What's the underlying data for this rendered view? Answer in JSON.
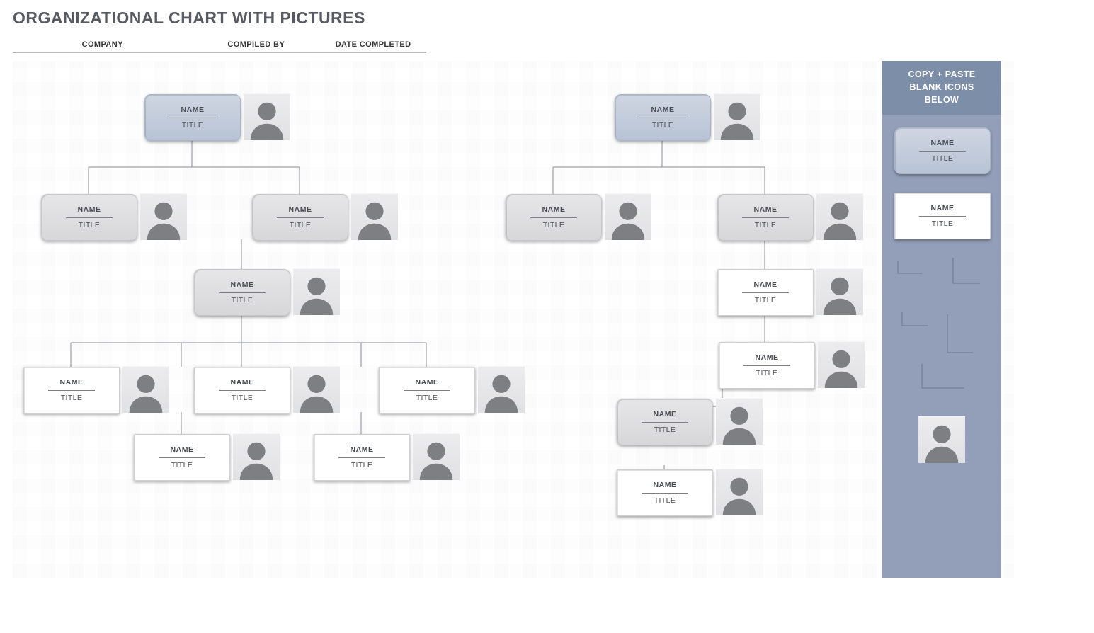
{
  "title": "ORGANIZATIONAL CHART WITH PICTURES",
  "meta": {
    "col1": "COMPANY",
    "col2": "COMPILED BY",
    "col3": "DATE COMPLETED"
  },
  "sidebar_heading_l1": "COPY + PASTE",
  "sidebar_heading_l2": "BLANK ICONS",
  "sidebar_heading_l3": "BELOW",
  "labels": {
    "name": "NAME",
    "title": "TITLE"
  },
  "nodes": {
    "a_top": {
      "name": "NAME",
      "title": "TITLE"
    },
    "a_l2a": {
      "name": "NAME",
      "title": "TITLE"
    },
    "a_l2b": {
      "name": "NAME",
      "title": "TITLE"
    },
    "a_l3": {
      "name": "NAME",
      "title": "TITLE"
    },
    "a_l4a": {
      "name": "NAME",
      "title": "TITLE"
    },
    "a_l4b": {
      "name": "NAME",
      "title": "TITLE"
    },
    "a_l4c": {
      "name": "NAME",
      "title": "TITLE"
    },
    "a_l5a": {
      "name": "NAME",
      "title": "TITLE"
    },
    "a_l5b": {
      "name": "NAME",
      "title": "TITLE"
    },
    "b_top": {
      "name": "NAME",
      "title": "TITLE"
    },
    "b_l2a": {
      "name": "NAME",
      "title": "TITLE"
    },
    "b_l2b": {
      "name": "NAME",
      "title": "TITLE"
    },
    "b_l3": {
      "name": "NAME",
      "title": "TITLE"
    },
    "b_l4": {
      "name": "NAME",
      "title": "TITLE"
    },
    "b_l5": {
      "name": "NAME",
      "title": "TITLE"
    },
    "b_l6": {
      "name": "NAME",
      "title": "TITLE"
    }
  },
  "sidebar_samples": {
    "blue": {
      "name": "NAME",
      "title": "TITLE"
    },
    "white": {
      "name": "NAME",
      "title": "TITLE"
    }
  }
}
